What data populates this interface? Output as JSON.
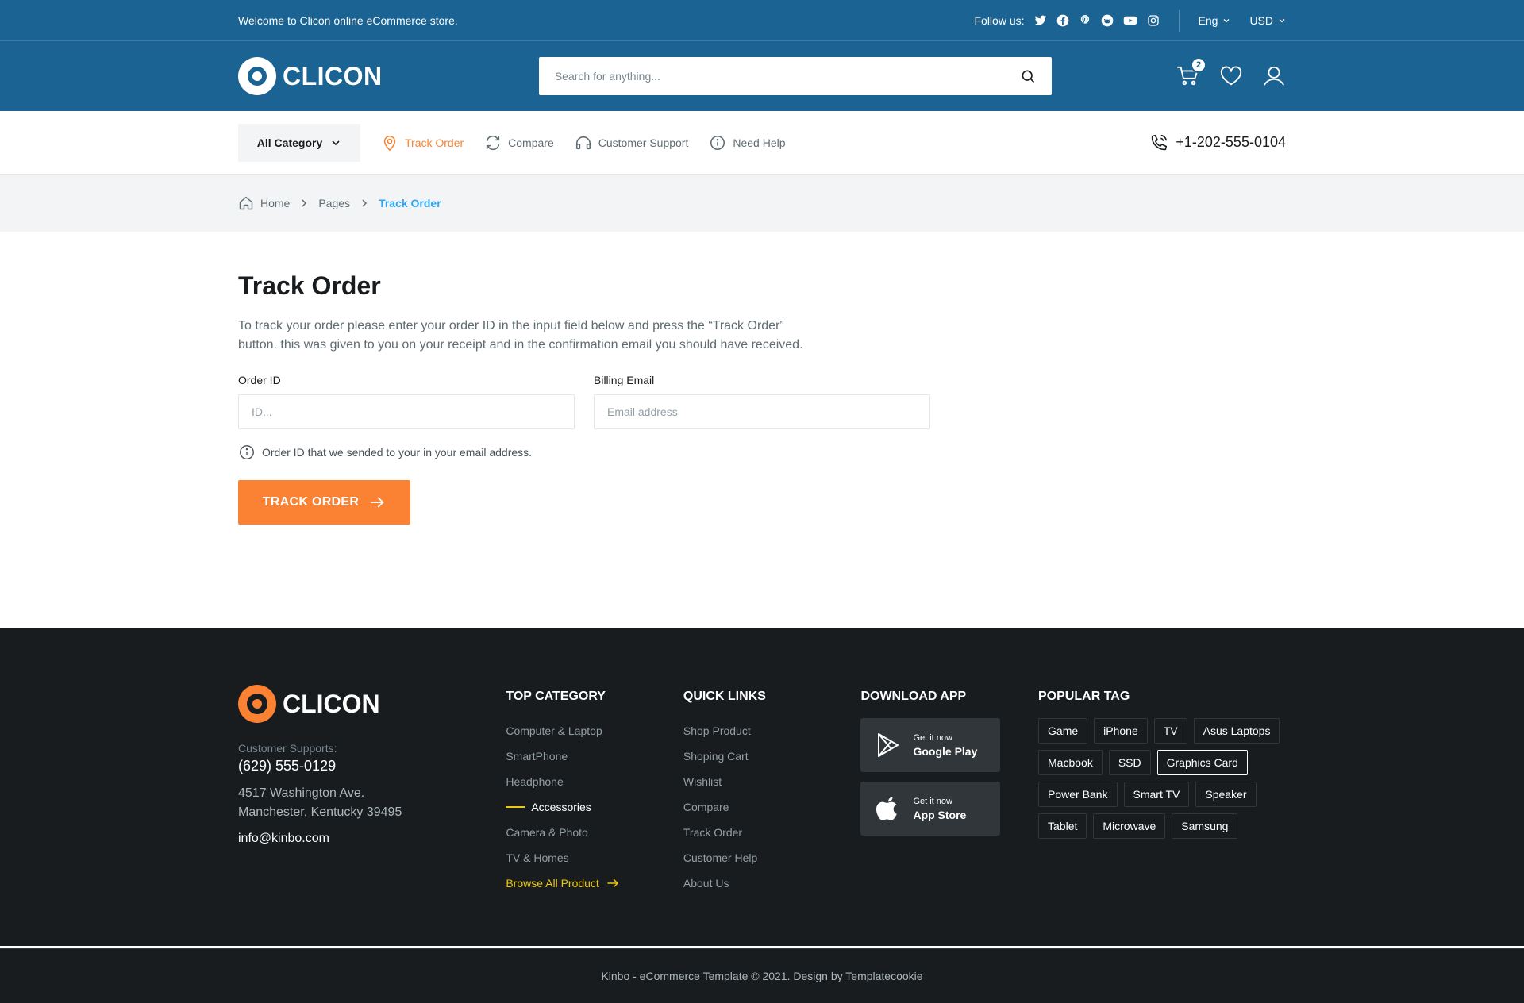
{
  "topbar": {
    "welcome": "Welcome to Clicon online eCommerce store.",
    "follow_label": "Follow us:",
    "socials": [
      "twitter-icon",
      "facebook-icon",
      "pinterest-icon",
      "reddit-icon",
      "youtube-icon",
      "instagram-icon"
    ],
    "language": "Eng",
    "currency": "USD"
  },
  "header": {
    "logo_text": "CLICON",
    "search_placeholder": "Search for anything...",
    "cart_count": "2"
  },
  "nav": {
    "all_category": "All Category",
    "items": [
      {
        "label": "Track Order",
        "icon": "map-pin-icon",
        "active": true
      },
      {
        "label": "Compare",
        "icon": "arrows-clockwise-icon"
      },
      {
        "label": "Customer Support",
        "icon": "headphones-icon"
      },
      {
        "label": "Need Help",
        "icon": "info-icon"
      }
    ],
    "phone": "+1-202-555-0104"
  },
  "breadcrumb": {
    "home": "Home",
    "pages": "Pages",
    "current": "Track Order"
  },
  "main": {
    "title": "Track Order",
    "description": "To track your order please enter your order ID in the input field below and press the “Track Order” button. this was given to you on your receipt and in the confirmation email you should have received.",
    "order_id_label": "Order ID",
    "order_id_placeholder": "ID...",
    "order_id_value": "",
    "email_label": "Billing Email",
    "email_placeholder": "Email address",
    "email_value": "",
    "hint": "Order ID that we sended to your in your email address.",
    "button_label": "TRACK ORDER"
  },
  "footer": {
    "logo_text": "CLICON",
    "support_label": "Customer Supports:",
    "support_phone": "(629) 555-0129",
    "address": "4517 Washington Ave. Manchester, Kentucky 39495",
    "email": "info@kinbo.com",
    "top_category": {
      "heading": "TOP CATEGORY",
      "items": [
        "Computer & Laptop",
        "SmartPhone",
        "Headphone",
        "Accessories",
        "Camera & Photo",
        "TV & Homes"
      ],
      "browse": "Browse All Product"
    },
    "quick_links": {
      "heading": "QUICK LINKS",
      "items": [
        "Shop Product",
        "Shoping Cart",
        "Wishlist",
        "Compare",
        "Track Order",
        "Customer Help",
        "About Us"
      ]
    },
    "download": {
      "heading": "DOWNLOAD APP",
      "google_small": "Get it now",
      "google_big": "Google Play",
      "apple_small": "Get it now",
      "apple_big": "App Store"
    },
    "tags": {
      "heading": "POPULAR TAG",
      "items": [
        "Game",
        "iPhone",
        "TV",
        "Asus Laptops",
        "Macbook",
        "SSD",
        "Graphics Card",
        "Power Bank",
        "Smart TV",
        "Speaker",
        "Tablet",
        "Microwave",
        "Samsung"
      ],
      "active": "Graphics Card"
    },
    "copyright": "Kinbo - eCommerce Template © 2021. Design by Templatecookie"
  },
  "colors": {
    "primary": "#1b6392",
    "accent": "#fa8232",
    "link": "#2da5f3",
    "footer_bg": "#191c1f",
    "highlight": "#ebc80c"
  }
}
